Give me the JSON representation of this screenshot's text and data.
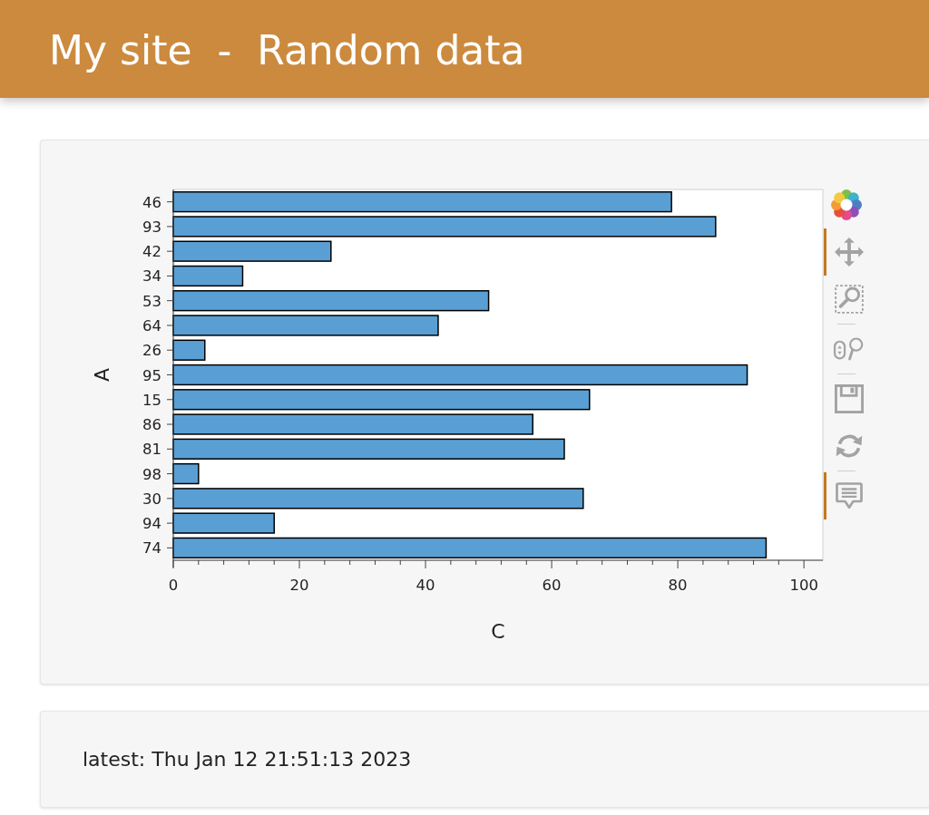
{
  "header": {
    "title": "My site  -  Random data"
  },
  "plot_card": {
    "chart_data": {
      "type": "bar",
      "orientation": "horizontal",
      "xlabel": "C",
      "ylabel": "A",
      "categories": [
        "46",
        "93",
        "42",
        "34",
        "53",
        "64",
        "26",
        "95",
        "15",
        "86",
        "81",
        "98",
        "30",
        "94",
        "74"
      ],
      "series": [
        {
          "color": "#5a9fd4",
          "values": [
            79,
            86,
            25,
            11,
            50,
            42,
            5,
            91,
            66,
            57,
            62,
            4,
            65,
            16,
            94
          ]
        }
      ],
      "xlim": [
        0,
        103
      ],
      "xticks": [
        0,
        20,
        40,
        60,
        80,
        100
      ]
    },
    "toolbar": {
      "tool_groups": [
        {
          "tools": [
            {
              "kind": "pan",
              "active": true
            },
            {
              "kind": "box_zoom",
              "active": false
            }
          ]
        },
        {
          "tools": [
            {
              "kind": "wheel_zoom",
              "active": false
            }
          ]
        },
        {
          "tools": [
            {
              "kind": "save",
              "active": false
            },
            {
              "kind": "reset",
              "active": false
            }
          ]
        },
        {
          "tools": [
            {
              "kind": "hover",
              "active": true
            }
          ]
        }
      ]
    }
  },
  "status_card": {
    "text": "latest: Thu Jan 12 21:51:13 2023"
  }
}
